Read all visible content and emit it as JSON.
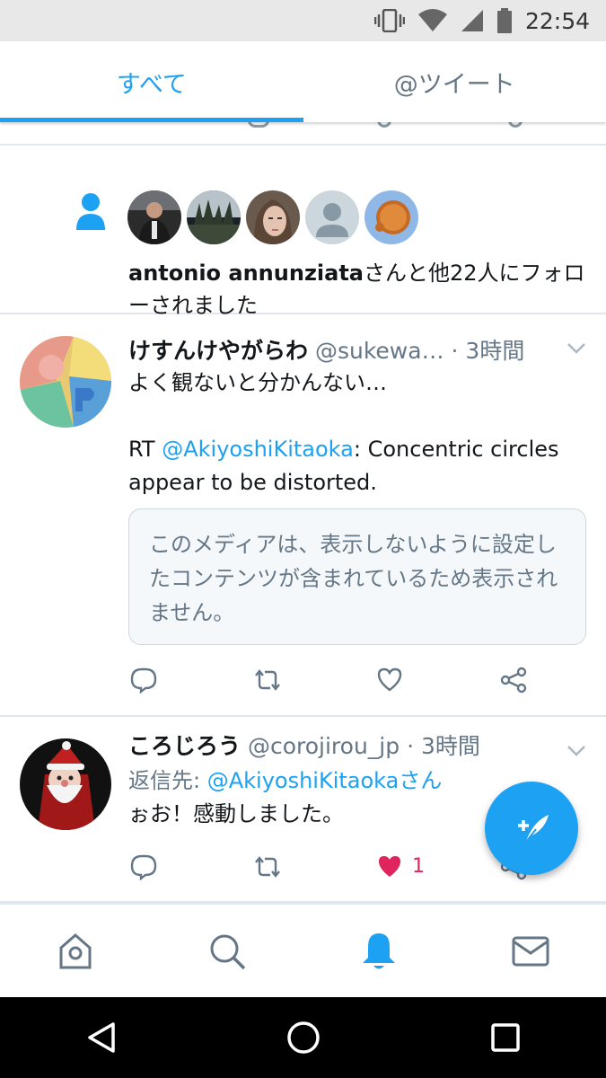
{
  "status_bar": {
    "time": "22:54"
  },
  "tabs": [
    {
      "label": "すべて",
      "active": true
    },
    {
      "label": "@ツイート",
      "active": false
    }
  ],
  "follow_notification": {
    "name": "antonio annunziata",
    "text": "さんと他22人にフォローされました",
    "avatar_count": 5
  },
  "tweets": [
    {
      "display_name": "けすんけやがらわ",
      "handle": "@sukewa…",
      "time": "· 3時間",
      "line1": "よく観ないと分かんない…",
      "rt_prefix": "RT ",
      "mention": "@AkiyoshiKitaoka",
      "rt_text": ": Concentric circles appear to be distorted.",
      "media_notice": "このメディアは、表示しないように設定したコンテンツが含まれているため表示されません。"
    },
    {
      "display_name": "ころじろう",
      "handle": "@corojirou_jp",
      "time": "· 3時間",
      "reply_prefix": "返信先: ",
      "reply_target": "@AkiyoshiKitaokaさん",
      "text": "ぉお！感動しました。",
      "like_count": "1",
      "liked": true
    }
  ],
  "colors": {
    "accent": "#1da1f2",
    "like": "#e0245e",
    "secondary": "#657786"
  },
  "icons": {
    "bottom_nav": [
      "home-icon",
      "search-icon",
      "notifications-bell-icon",
      "messages-envelope-icon"
    ],
    "system_nav": [
      "back-triangle-icon",
      "home-circle-icon",
      "recents-square-icon"
    ]
  }
}
